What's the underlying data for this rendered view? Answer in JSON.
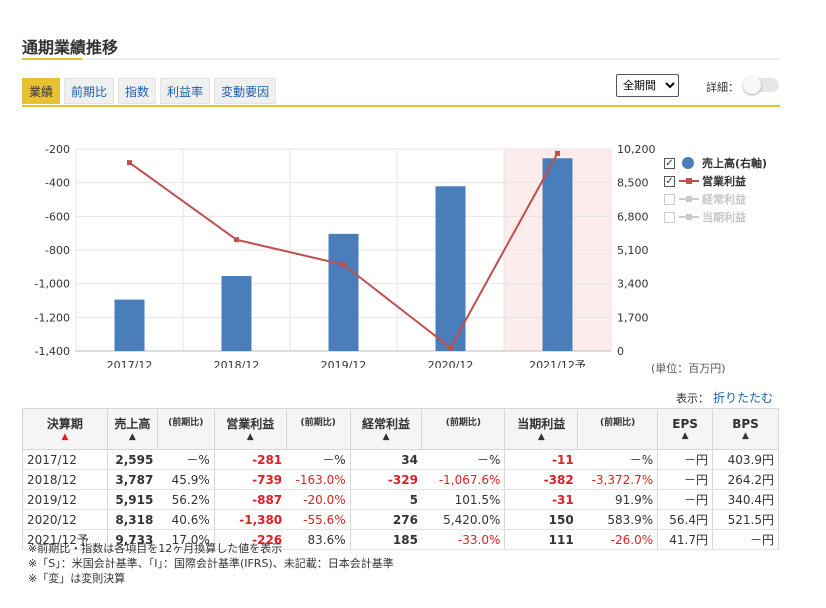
{
  "header": {
    "title": "通期業績推移"
  },
  "tabs": [
    {
      "label": "業績",
      "active": true
    },
    {
      "label": "前期比",
      "active": false
    },
    {
      "label": "指数",
      "active": false
    },
    {
      "label": "利益率",
      "active": false
    },
    {
      "label": "変動要因",
      "active": false
    }
  ],
  "controls": {
    "period_selected": "全期間",
    "detail_label": "詳細：",
    "detail_enabled": false
  },
  "chart_data": {
    "type": "bar",
    "categories": [
      "2017/12",
      "2018/12",
      "2019/12",
      "2020/12",
      "2021/12予"
    ],
    "highlight_category": "2021/12予",
    "left_axis": {
      "ylim": [
        -1400,
        -200
      ],
      "ticks": [
        "-200",
        "-400",
        "-600",
        "-800",
        "-1,000",
        "-1,200",
        "-1,400"
      ]
    },
    "right_axis": {
      "ylim": [
        0,
        10200
      ],
      "ticks": [
        "10,200",
        "8,500",
        "6,800",
        "5,100",
        "3,400",
        "1,700",
        "0"
      ]
    },
    "series": [
      {
        "name": "売上高(右軸)",
        "type": "bar",
        "axis": "right",
        "color": "#4a7ebb",
        "values": [
          2595,
          3787,
          5915,
          8318,
          9733
        ],
        "checked": true
      },
      {
        "name": "営業利益",
        "type": "line",
        "axis": "left",
        "color": "#c0504d",
        "values": [
          -281,
          -739,
          -887,
          -1380,
          -226
        ],
        "checked": true
      },
      {
        "name": "経常利益",
        "type": "line",
        "axis": "left",
        "color": "#c8c8c8",
        "checked": false
      },
      {
        "name": "当期利益",
        "type": "line",
        "axis": "left",
        "color": "#c8c8c8",
        "checked": false
      }
    ],
    "unit_label": "(単位：百万円)",
    "grid": true,
    "legend_position": "right"
  },
  "display": {
    "label": "表示：",
    "toggle_link": "折りたたむ"
  },
  "table": {
    "headers": {
      "period": "決算期",
      "sales": "売上高",
      "yoy": "(前期比)",
      "op": "営業利益",
      "ord": "経常利益",
      "net": "当期利益",
      "eps": "EPS",
      "bps": "BPS",
      "arrow_active": "▲",
      "arrow": "▲"
    },
    "rows": [
      {
        "period": "2017/12",
        "sales": "2,595",
        "sales_yoy": "－%",
        "op": "-281",
        "op_yoy": "－%",
        "ord": "34",
        "ord_yoy": "－%",
        "net": "-11",
        "net_yoy": "－%",
        "eps": "－円",
        "bps": "403.9円"
      },
      {
        "period": "2018/12",
        "sales": "3,787",
        "sales_yoy": "45.9%",
        "op": "-739",
        "op_yoy": "-163.0%",
        "ord": "-329",
        "ord_yoy": "-1,067.6%",
        "net": "-382",
        "net_yoy": "-3,372.7%",
        "eps": "－円",
        "bps": "264.2円"
      },
      {
        "period": "2019/12",
        "sales": "5,915",
        "sales_yoy": "56.2%",
        "op": "-887",
        "op_yoy": "-20.0%",
        "ord": "5",
        "ord_yoy": "101.5%",
        "net": "-31",
        "net_yoy": "91.9%",
        "eps": "－円",
        "bps": "340.4円"
      },
      {
        "period": "2020/12",
        "sales": "8,318",
        "sales_yoy": "40.6%",
        "op": "-1,380",
        "op_yoy": "-55.6%",
        "ord": "276",
        "ord_yoy": "5,420.0%",
        "net": "150",
        "net_yoy": "583.9%",
        "eps": "56.4円",
        "bps": "521.5円"
      },
      {
        "period": "2021/12予",
        "sales": "9,733",
        "sales_yoy": "17.0%",
        "op": "-226",
        "op_yoy": "83.6%",
        "ord": "185",
        "ord_yoy": "-33.0%",
        "net": "111",
        "net_yoy": "-26.0%",
        "eps": "41.7円",
        "bps": "－円"
      }
    ]
  },
  "notes": [
    "※前期比・指数は各項目を12ヶ月換算した値を表示",
    "※「S」：米国会計基準、「I」：国際会計基準(IFRS)、未記載：日本会計基準",
    "※「変」は変則決算"
  ],
  "colors": {
    "accent": "#e8c133",
    "link": "#1f5fa8",
    "negative": "#e02020",
    "highlight_bg": "#fdecec"
  }
}
